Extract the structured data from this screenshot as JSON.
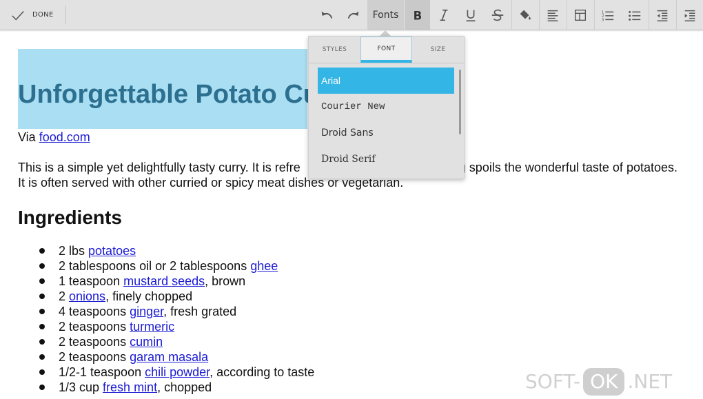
{
  "toolbar": {
    "done_label": "DONE",
    "fonts_label": "Fonts",
    "icons": {
      "done": "check-icon",
      "undo": "undo-icon",
      "redo": "redo-icon",
      "bold": "bold-icon",
      "italic": "italic-icon",
      "underline": "underline-icon",
      "strikethrough": "strikethrough-icon",
      "fill": "paint-bucket-icon",
      "align": "align-left-icon",
      "table": "table-icon",
      "ordered_list": "ordered-list-icon",
      "bullet_list": "bullet-list-icon",
      "outdent": "outdent-icon",
      "indent": "indent-icon"
    }
  },
  "popup": {
    "tabs": [
      {
        "label": "STYLES",
        "active": false
      },
      {
        "label": "FONT",
        "active": true
      },
      {
        "label": "SIZE",
        "active": false
      }
    ],
    "fonts": [
      {
        "label": "Arial",
        "selected": true
      },
      {
        "label": "Courier New",
        "selected": false
      },
      {
        "label": "Droid Sans",
        "selected": false
      },
      {
        "label": "Droid Serif",
        "selected": false
      }
    ]
  },
  "document": {
    "title": "Unforgettable Potato Cu",
    "via_prefix": "Via ",
    "via_link": "food.com",
    "intro_part1": "This is a simple yet delightfully tasty curry. It is refre",
    "intro_part2": "g spoils the wonderful taste of potatoes. It is often served with other curried or spicy meat dishes or vegetarian.",
    "ingredients_heading": "Ingredients",
    "ingredients": [
      {
        "pre": "2 lbs ",
        "link": "potatoes",
        "post": ""
      },
      {
        "pre": "2 tablespoons oil or 2 tablespoons ",
        "link": "ghee",
        "post": ""
      },
      {
        "pre": "1 teaspoon ",
        "link": "mustard seeds",
        "post": ", brown"
      },
      {
        "pre": "2 ",
        "link": "onions",
        "post": ", finely chopped"
      },
      {
        "pre": "4 teaspoons ",
        "link": "ginger",
        "post": ", fresh grated"
      },
      {
        "pre": "2 teaspoons ",
        "link": "turmeric",
        "post": ""
      },
      {
        "pre": "2 teaspoons ",
        "link": "cumin",
        "post": ""
      },
      {
        "pre": "2 teaspoons ",
        "link": "garam masala",
        "post": ""
      },
      {
        "pre": "1/2-1 teaspoon ",
        "link": "chili powder",
        "post": ", according to taste"
      },
      {
        "pre": "1/3 cup ",
        "link": "fresh mint",
        "post": ", chopped"
      }
    ]
  },
  "watermark": {
    "prefix": "SOFT-",
    "ok": "OK",
    "suffix": ".NET"
  },
  "colors": {
    "accent": "#33b5e5",
    "highlight": "#a9def3",
    "link": "#1b1bd4",
    "title": "#2c6f8f"
  }
}
